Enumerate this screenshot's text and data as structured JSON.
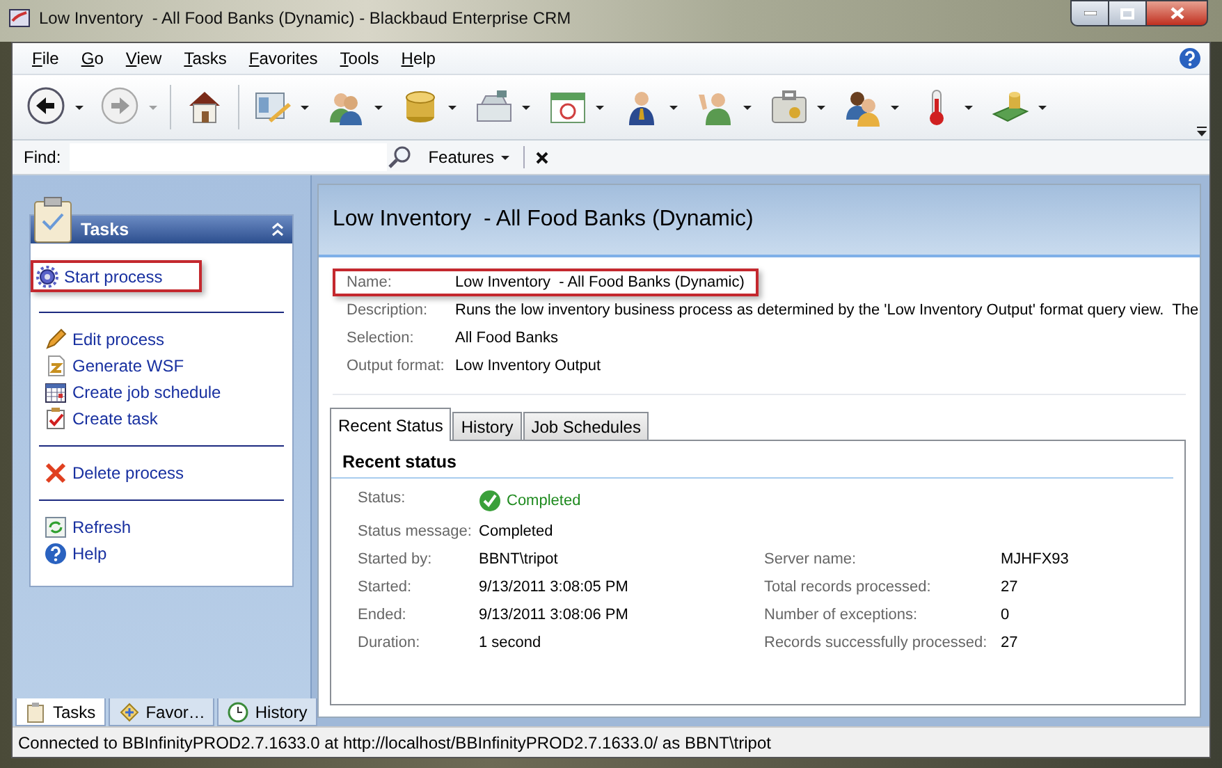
{
  "window": {
    "title": "Low Inventory  - All Food Banks (Dynamic) - Blackbaud Enterprise CRM"
  },
  "menu": [
    "File",
    "Go",
    "View",
    "Tasks",
    "Favorites",
    "Tools",
    "Help"
  ],
  "find": {
    "label": "Find:",
    "features": "Features"
  },
  "tasks": {
    "title": "Tasks",
    "groups": [
      [
        {
          "label": "Start process",
          "highlighted": true
        }
      ],
      [
        {
          "label": "Edit process",
          "highlighted": false
        },
        {
          "label": "Generate WSF",
          "highlighted": false
        },
        {
          "label": "Create job schedule",
          "highlighted": false
        },
        {
          "label": "Create task",
          "highlighted": false
        }
      ],
      [
        {
          "label": "Delete process",
          "highlighted": false
        }
      ],
      [
        {
          "label": "Refresh",
          "highlighted": false
        },
        {
          "label": "Help",
          "highlighted": false
        }
      ]
    ]
  },
  "nav_tabs": [
    {
      "label": "Tasks",
      "selected": true
    },
    {
      "label": "Favor…",
      "selected": false
    },
    {
      "label": "History",
      "selected": false
    }
  ],
  "page": {
    "title": "Low Inventory  - All Food Banks (Dynamic)",
    "fields": [
      {
        "label": "Name:",
        "value": "Low Inventory  - All Food Banks (Dynamic)",
        "highlighted": true
      },
      {
        "label": "Description:",
        "value": "Runs the low inventory business process as determined by the 'Low Inventory Output' format query view.  The",
        "highlighted": false
      },
      {
        "label": "Selection:",
        "value": "All Food Banks",
        "highlighted": false
      },
      {
        "label": "Output format:",
        "value": "Low Inventory Output",
        "highlighted": false
      }
    ],
    "tabs": [
      {
        "label": "Recent Status",
        "selected": true
      },
      {
        "label": "History",
        "selected": false
      },
      {
        "label": "Job Schedules",
        "selected": false
      }
    ],
    "section": "Recent status",
    "status": {
      "label": "Status:",
      "value": "Completed"
    },
    "status_message": {
      "label": "Status message:",
      "value": "Completed"
    },
    "details_left": [
      {
        "label": "Started by:",
        "value": "BBNT\\tripot"
      },
      {
        "label": "Started:",
        "value": "9/13/2011 3:08:05 PM"
      },
      {
        "label": "Ended:",
        "value": "9/13/2011 3:08:06 PM"
      },
      {
        "label": "Duration:",
        "value": "1 second"
      }
    ],
    "details_right": [
      {
        "label": "Server name:",
        "value": "MJHFX93"
      },
      {
        "label": "Total records processed:",
        "value": "27"
      },
      {
        "label": "Number of exceptions:",
        "value": "0"
      },
      {
        "label": "Records successfully processed:",
        "value": "27"
      }
    ]
  },
  "status_bar": "Connected to BBInfinityPROD2.7.1633.0 at http://localhost/BBInfinityPROD2.7.1633.0/ as BBNT\\tripot"
}
